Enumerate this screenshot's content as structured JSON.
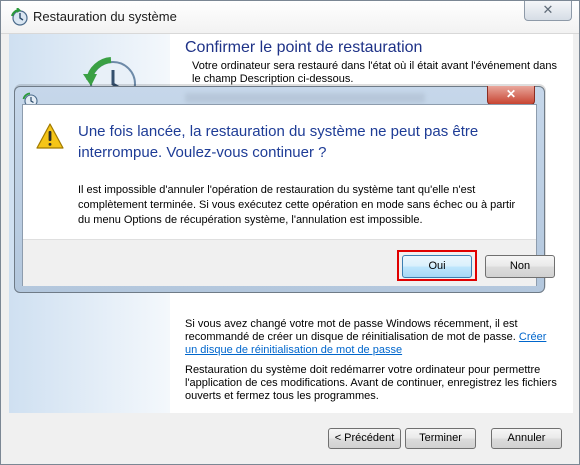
{
  "window": {
    "title": "Restauration du système",
    "close_glyph": "✕",
    "app_icon": "system-restore-icon"
  },
  "main": {
    "heading": "Confirmer le point de restauration",
    "description": "Votre ordinateur sera restauré dans l'état où il était avant l'événement dans le champ Description ci-dessous.",
    "info1_text": "Si vous avez changé votre mot de passe Windows récemment, il est recommandé de créer un disque de réinitialisation de mot de passe.",
    "info1_link": "Créer un disque de réinitialisation de mot de passe",
    "info2_text": "Restauration du système doit redémarrer votre ordinateur pour permettre l'application de ces modifications. Avant de continuer, enregistrez les fichiers ouverts et fermez tous les programmes."
  },
  "footer": {
    "prev_label": "< Précédent",
    "finish_label": "Terminer",
    "cancel_label": "Annuler"
  },
  "dialog": {
    "close_glyph": "✕",
    "main_instruction": "Une fois lancée, la restauration du système ne peut pas être interrompue. Voulez-vous continuer ?",
    "body": "Il est impossible d'annuler l'opération de restauration du système tant qu'elle n'est complètement terminée. Si vous exécutez cette opération en mode sans échec ou à partir du menu Options de récupération système, l'annulation est impossible.",
    "yes_label": "Oui",
    "no_label": "Non",
    "icon": "warning-icon"
  },
  "colors": {
    "heading": "#1e3287",
    "dialog_text": "#1e3c96",
    "link": "#0066cc",
    "highlight": "#e00000"
  }
}
